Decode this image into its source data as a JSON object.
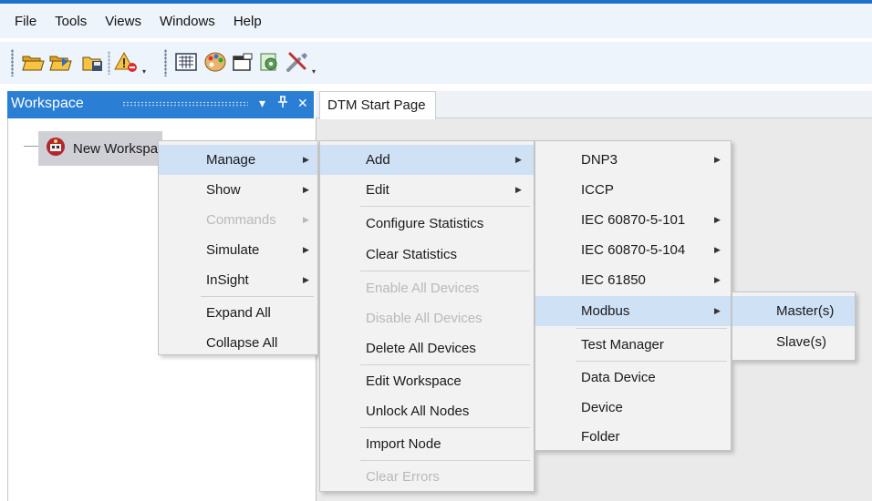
{
  "menubar": {
    "items": [
      "File",
      "Tools",
      "Views",
      "Windows",
      "Help"
    ]
  },
  "toolbar": {
    "buttons": [
      "open-folder-icon",
      "import-folder-icon",
      "save-icon",
      "warning-icon",
      "grid-view-icon",
      "palette-icon",
      "window-icon",
      "network-device-icon",
      "tools-icon"
    ]
  },
  "workspace": {
    "title": "Workspace",
    "dropdown_glyph": "▾",
    "pin_glyph": "⊥",
    "close_glyph": "✕",
    "tree_node_label": "New Workspace"
  },
  "document": {
    "tab_label": "DTM Start Page"
  },
  "menus": {
    "context": {
      "items": [
        {
          "label": "Manage",
          "submenu": true,
          "highlighted": true
        },
        {
          "label": "Show",
          "submenu": true
        },
        {
          "label": "Commands",
          "submenu": true,
          "disabled": true
        },
        {
          "label": "Simulate",
          "submenu": true
        },
        {
          "label": "InSight",
          "submenu": true
        },
        {
          "label": "Expand All"
        },
        {
          "label": "Collapse All"
        }
      ]
    },
    "manage": {
      "items": [
        {
          "label": "Add",
          "submenu": true,
          "highlighted": true
        },
        {
          "label": "Edit",
          "submenu": true
        },
        {
          "label": "Configure Statistics"
        },
        {
          "label": "Clear Statistics"
        },
        {
          "label": "Enable All Devices",
          "disabled": true
        },
        {
          "label": "Disable All Devices",
          "disabled": true
        },
        {
          "label": "Delete All Devices"
        },
        {
          "label": "Edit Workspace"
        },
        {
          "label": "Unlock All Nodes"
        },
        {
          "label": "Import Node"
        },
        {
          "label": "Clear Errors",
          "disabled": true
        }
      ]
    },
    "add": {
      "items": [
        {
          "label": "DNP3",
          "submenu": true
        },
        {
          "label": "ICCP"
        },
        {
          "label": "IEC 60870-5-101",
          "submenu": true
        },
        {
          "label": "IEC 60870-5-104",
          "submenu": true
        },
        {
          "label": "IEC 61850",
          "submenu": true
        },
        {
          "label": "Modbus",
          "submenu": true,
          "highlighted": true
        },
        {
          "label": "Test Manager"
        },
        {
          "label": "Data Device"
        },
        {
          "label": "Device"
        },
        {
          "label": "Folder"
        }
      ]
    },
    "modbus": {
      "items": [
        {
          "label": "Master(s)",
          "highlighted": true
        },
        {
          "label": "Slave(s)"
        }
      ]
    }
  },
  "colors": {
    "accent": "#2a7fd4",
    "highlight": "#cfe1f5",
    "menu_bg": "#f2f2f2",
    "disabled_text": "#b9b9b9"
  }
}
